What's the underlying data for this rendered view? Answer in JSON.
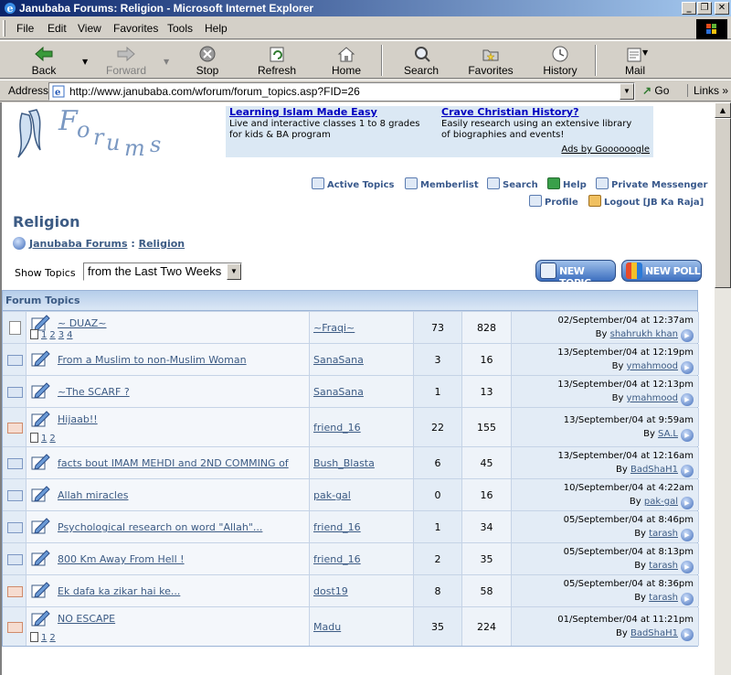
{
  "window": {
    "title": "Janubaba Forums: Religion - Microsoft Internet Explorer"
  },
  "menu": [
    "File",
    "Edit",
    "View",
    "Favorites",
    "Tools",
    "Help"
  ],
  "toolbar": {
    "back": "Back",
    "forward": "Forward",
    "stop": "Stop",
    "refresh": "Refresh",
    "home": "Home",
    "search": "Search",
    "favorites": "Favorites",
    "history": "History",
    "mail": "Mail"
  },
  "address": {
    "label": "Address",
    "url": "http://www.janubaba.com/wforum/forum_topics.asp?FID=26",
    "go": "Go",
    "links": "Links"
  },
  "ads": {
    "ad1": {
      "title": "Learning Islam Made Easy",
      "text": "Live and interactive classes 1 to 8 grades for kids & BA program"
    },
    "ad2": {
      "title": "Crave Christian History?",
      "text": "Easily research using an extensive library of biographies and events!"
    },
    "by": "Ads by Goooooogle"
  },
  "nav": {
    "active_topics": "Active Topics",
    "memberlist": "Memberlist",
    "search": "Search",
    "help": "Help",
    "private_messenger": "Private Messenger",
    "profile": "Profile",
    "logout": "Logout [JB Ka Raja]"
  },
  "page_title": "Religion",
  "breadcrumb": {
    "home": "Janubaba Forums",
    "sep": ":",
    "current": "Religion"
  },
  "show_topics": {
    "label": "Show Topics",
    "selected": "from the Last Two Weeks"
  },
  "buttons": {
    "new_topic": "NEW TOPIC",
    "new_poll": "NEW POLL"
  },
  "table": {
    "header": "Forum Topics",
    "rows": [
      {
        "topic": "~ DUAZ~",
        "pages": [
          "1",
          "2",
          "3",
          "4"
        ],
        "author": "~Fraqi~",
        "replies": "73",
        "views": "828",
        "date": "02/September/04 at 12:37am",
        "by": "shahrukh khan",
        "hot": false,
        "doc": true
      },
      {
        "topic": "From a Muslim to non-Muslim Woman",
        "pages": [],
        "author": "SanaSana",
        "replies": "3",
        "views": "16",
        "date": "13/September/04 at 12:19pm",
        "by": "ymahmood",
        "hot": false,
        "doc": false
      },
      {
        "topic": "~The SCARF ?",
        "pages": [],
        "author": "SanaSana",
        "replies": "1",
        "views": "13",
        "date": "13/September/04 at 12:13pm",
        "by": "ymahmood",
        "hot": false,
        "doc": false
      },
      {
        "topic": "Hijaab!!",
        "pages": [
          "1",
          "2"
        ],
        "author": "friend_16",
        "replies": "22",
        "views": "155",
        "date": "13/September/04 at 9:59am",
        "by": "SA.L",
        "hot": true,
        "doc": false
      },
      {
        "topic": "facts bout IMAM MEHDI and 2ND COMMING of",
        "pages": [],
        "author": "Bush_Blasta",
        "replies": "6",
        "views": "45",
        "date": "13/September/04 at 12:16am",
        "by": "BadShaH1",
        "hot": false,
        "doc": false
      },
      {
        "topic": "Allah miracles",
        "pages": [],
        "author": "pak-gal",
        "replies": "0",
        "views": "16",
        "date": "10/September/04 at 4:22am",
        "by": "pak-gal",
        "hot": false,
        "doc": false
      },
      {
        "topic": "Psychological research on word \"Allah\"...",
        "pages": [],
        "author": "friend_16",
        "replies": "1",
        "views": "34",
        "date": "05/September/04 at 8:46pm",
        "by": "tarash",
        "hot": false,
        "doc": false
      },
      {
        "topic": "800 Km Away From Hell !",
        "pages": [],
        "author": "friend_16",
        "replies": "2",
        "views": "35",
        "date": "05/September/04 at 8:13pm",
        "by": "tarash",
        "hot": false,
        "doc": false
      },
      {
        "topic": "Ek dafa ka zikar hai ke...",
        "pages": [],
        "author": "dost19",
        "replies": "8",
        "views": "58",
        "date": "05/September/04 at 8:36pm",
        "by": "tarash",
        "hot": true,
        "doc": false
      },
      {
        "topic": "NO ESCAPE",
        "pages": [
          "1",
          "2"
        ],
        "author": "Madu",
        "replies": "35",
        "views": "224",
        "date": "01/September/04 at 11:21pm",
        "by": "BadShaH1",
        "hot": true,
        "doc": false
      }
    ]
  }
}
